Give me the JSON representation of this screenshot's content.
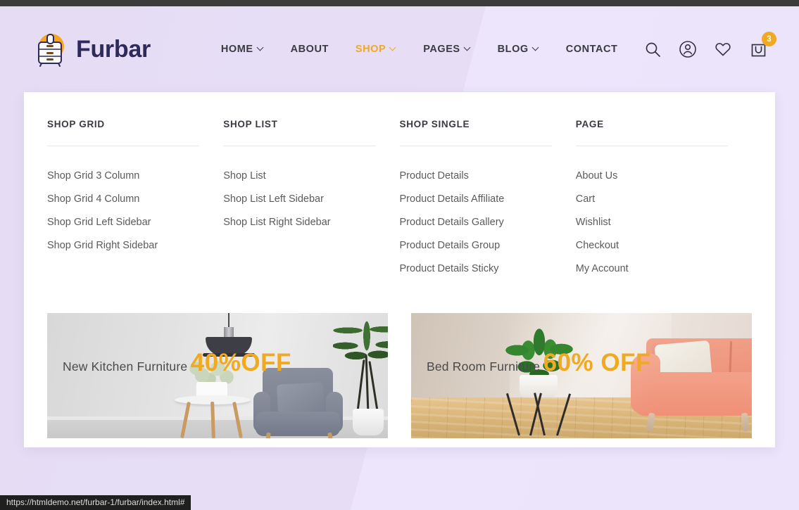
{
  "site": {
    "brand_name": "Furbar",
    "logo_icon": "dresser-cabinet-icon",
    "accent_color": "#f0a921",
    "header_bg": "#e9e1f7",
    "brand_text_color": "#2e2a5a"
  },
  "nav": {
    "items": [
      {
        "label": "HOME",
        "has_caret": true,
        "active": false
      },
      {
        "label": "ABOUT",
        "has_caret": false,
        "active": false
      },
      {
        "label": "SHOP",
        "has_caret": true,
        "active": true
      },
      {
        "label": "PAGES",
        "has_caret": true,
        "active": false
      },
      {
        "label": "BLOG",
        "has_caret": true,
        "active": false
      },
      {
        "label": "CONTACT",
        "has_caret": false,
        "active": false
      }
    ]
  },
  "header_icons": {
    "search": "search-icon",
    "account": "user-account-icon",
    "wishlist": "heart-icon",
    "cart": "shopping-bag-icon",
    "cart_count": "3"
  },
  "megamenu": {
    "columns": [
      {
        "title": "SHOP GRID",
        "links": [
          "Shop Grid 3 Column",
          "Shop Grid 4 Column",
          "Shop Grid Left Sidebar",
          "Shop Grid Right Sidebar"
        ]
      },
      {
        "title": "SHOP LIST",
        "links": [
          "Shop List",
          "Shop List Left Sidebar",
          "Shop List Right Sidebar"
        ]
      },
      {
        "title": "SHOP SINGLE",
        "links": [
          "Product Details",
          "Product Details Affiliate",
          "Product Details Gallery",
          "Product Details Group",
          "Product Details Sticky"
        ]
      },
      {
        "title": "PAGE",
        "links": [
          "About Us",
          "Cart",
          "Wishlist",
          "Checkout",
          "My Account"
        ]
      }
    ],
    "banners": [
      {
        "heading": "New Kitchen Furniture",
        "offer": "40%OFF",
        "scene": "grey-living-room-with-armchair"
      },
      {
        "heading": "Bed Room Furniture",
        "offer": "60% OFF",
        "scene": "beige-room-with-coral-sofa"
      }
    ]
  },
  "statusbar": {
    "url": "https://htmldemo.net/furbar-1/furbar/index.html#"
  }
}
